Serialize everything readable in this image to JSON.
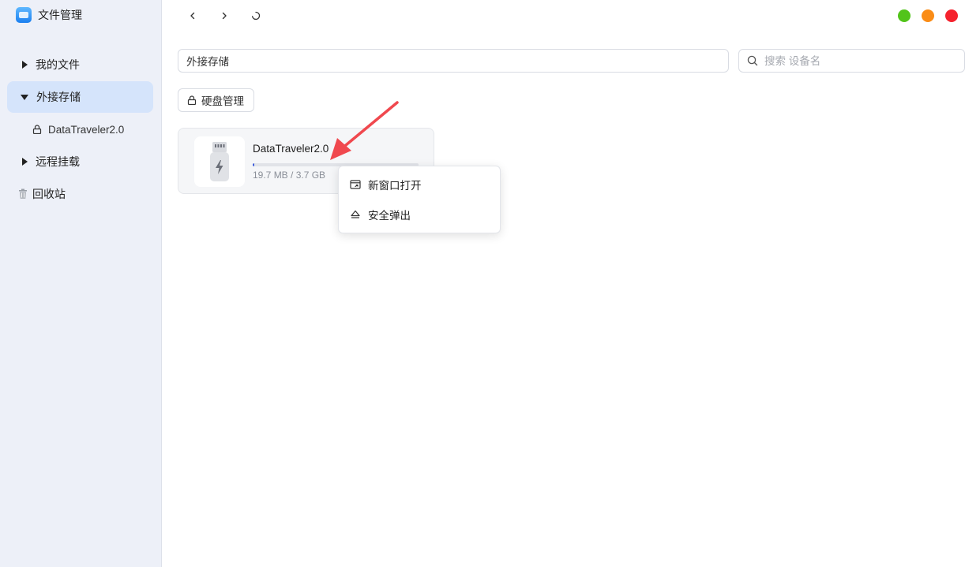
{
  "app": {
    "title": "文件管理"
  },
  "sidebar": {
    "items": [
      {
        "label": "我的文件"
      },
      {
        "label": "外接存储"
      },
      {
        "label": "DataTraveler2.0"
      },
      {
        "label": "远程挂载"
      },
      {
        "label": "回收站"
      }
    ]
  },
  "toolbar": {
    "back_icon": "chevron-left-icon",
    "forward_icon": "chevron-right-icon",
    "refresh_icon": "refresh-icon"
  },
  "window_controls": {
    "colors": {
      "maximize": "#52c41a",
      "minimize": "#fa8c16",
      "close": "#f5222d"
    }
  },
  "path_bar": {
    "value": "外接存储"
  },
  "search": {
    "placeholder": "搜索 设备名"
  },
  "disk_manage": {
    "label": "硬盘管理"
  },
  "device": {
    "name": "DataTraveler2.0",
    "size_text": "19.7 MB / 3.7 GB",
    "used_fraction": 0.005
  },
  "context_menu": {
    "items": [
      {
        "label": "新窗口打开"
      },
      {
        "label": "安全弹出"
      }
    ]
  },
  "colors": {
    "accent": "#3b5bdb",
    "sidebar_bg": "#edf0f8",
    "active_item_bg": "#d5e4fb",
    "arrow": "#f0484e"
  }
}
